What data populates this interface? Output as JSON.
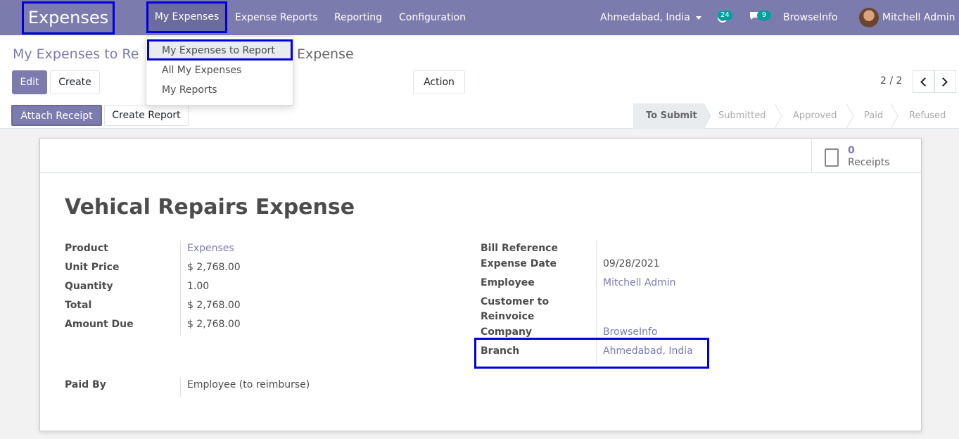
{
  "navbar": {
    "brand": "Expenses",
    "menu": [
      "My Expenses",
      "Expense Reports",
      "Reporting",
      "Configuration"
    ],
    "branch_switcher": "Ahmedabad, India",
    "activity_count": "24",
    "message_count": "9",
    "company": "BrowseInfo",
    "user": "Mitchell Admin"
  },
  "dropdown": {
    "items": [
      "My Expenses to Report",
      "All My Expenses",
      "My Reports"
    ]
  },
  "breadcrumb": {
    "parent": "My Expenses to Re",
    "current": "Expense"
  },
  "buttons": {
    "edit": "Edit",
    "create": "Create",
    "action": "Action",
    "attach_receipt": "Attach Receipt",
    "create_report": "Create Report"
  },
  "pager": {
    "value": "2 / 2"
  },
  "stages": [
    "To Submit",
    "Submitted",
    "Approved",
    "Paid",
    "Refused"
  ],
  "stat": {
    "value": "0",
    "label": "Receipts"
  },
  "record": {
    "title": "Vehical Repairs Expense",
    "left_fields": [
      {
        "label": "Product",
        "value": "Expenses"
      },
      {
        "label": "Unit Price",
        "value": "$ 2,768.00"
      },
      {
        "label": "Quantity",
        "value": "1.00"
      },
      {
        "label": "Total",
        "value": "$ 2,768.00"
      },
      {
        "label": "Amount Due",
        "value": "$ 2,768.00"
      }
    ],
    "right_fields": [
      {
        "label": "Bill Reference",
        "value": ""
      },
      {
        "label": "Expense Date",
        "value": "09/28/2021"
      },
      {
        "label": "Employee",
        "value": "Mitchell Admin"
      },
      {
        "label": "Customer to",
        "label2": "Reinvoice",
        "value": ""
      },
      {
        "label": "Company",
        "value": "BrowseInfo"
      },
      {
        "label": "Branch",
        "value": "Ahmedabad, India"
      }
    ],
    "paid_by": {
      "label": "Paid By",
      "value": "Employee (to reimburse)"
    }
  }
}
